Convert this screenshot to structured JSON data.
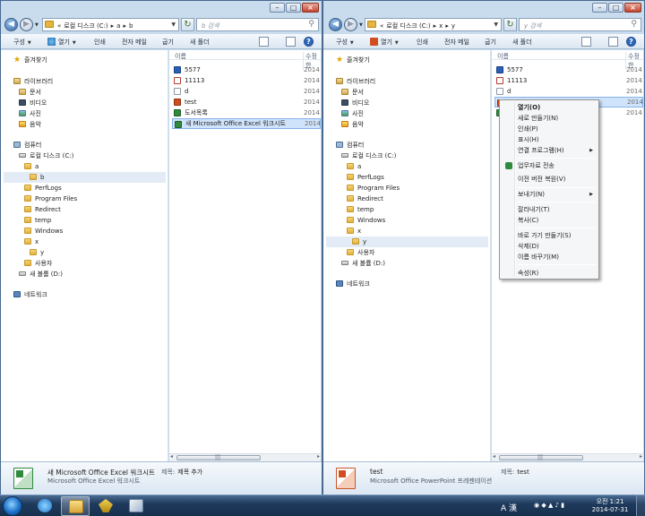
{
  "colors": {
    "window_frame": "#c9dced",
    "selection": "#cfe3fb",
    "taskbar": "#1f3a5c"
  },
  "left": {
    "address": {
      "crumbs": [
        "«",
        "로컬 디스크 (C:)",
        "▸",
        "a",
        "▸",
        "b"
      ]
    },
    "search_placeholder": "b 검색",
    "toolbar": {
      "organize": "구성",
      "open": "열기",
      "print": "인쇄",
      "email": "전자 메일",
      "burn": "굽기",
      "new_folder": "새 폴더"
    },
    "nav": [
      {
        "label": "즐겨찾기",
        "icon": "star-icon",
        "indent": 0
      },
      {
        "label": "라이브러리",
        "icon": "libraries-icon",
        "indent": 0
      },
      {
        "label": "문서",
        "icon": "documents-icon",
        "indent": 1
      },
      {
        "label": "비디오",
        "icon": "videos-icon",
        "indent": 1
      },
      {
        "label": "사진",
        "icon": "pictures-icon",
        "indent": 1
      },
      {
        "label": "음악",
        "icon": "music-icon",
        "indent": 1
      },
      {
        "label": "컴퓨터",
        "icon": "computer-icon",
        "indent": 0
      },
      {
        "label": "로컬 디스크 (C:)",
        "icon": "drive-icon",
        "indent": 1
      },
      {
        "label": "a",
        "icon": "folder-icon",
        "indent": 2
      },
      {
        "label": "b",
        "icon": "folder-icon",
        "indent": 3,
        "selected": true
      },
      {
        "label": "PerfLogs",
        "icon": "folder-icon",
        "indent": 2
      },
      {
        "label": "Program Files",
        "icon": "folder-icon",
        "indent": 2
      },
      {
        "label": "Redirect",
        "icon": "folder-icon",
        "indent": 2
      },
      {
        "label": "temp",
        "icon": "folder-icon",
        "indent": 2
      },
      {
        "label": "Windows",
        "icon": "folder-icon",
        "indent": 2
      },
      {
        "label": "x",
        "icon": "folder-icon",
        "indent": 2
      },
      {
        "label": "y",
        "icon": "folder-icon",
        "indent": 3
      },
      {
        "label": "사용자",
        "icon": "folder-icon",
        "indent": 2
      },
      {
        "label": "새 볼륨 (D:)",
        "icon": "drive-icon",
        "indent": 1
      },
      {
        "label": "네트워크",
        "icon": "network-icon",
        "indent": 0
      }
    ],
    "columns": {
      "name": "이름",
      "date": "수정한"
    },
    "files": [
      {
        "name": "5577",
        "date": "2014",
        "type": "word"
      },
      {
        "name": "11113",
        "date": "2014",
        "type": "pdf"
      },
      {
        "name": "d",
        "date": "2014",
        "type": "doc"
      },
      {
        "name": "test",
        "date": "2014",
        "type": "ppt"
      },
      {
        "name": "도서목록",
        "date": "2014",
        "type": "xls"
      },
      {
        "name": "새 Microsoft Office Excel 워크시트",
        "date": "2014",
        "type": "xls",
        "selected": true
      }
    ],
    "details": {
      "name": "새 Microsoft Office Excel 워크시트",
      "type": "Microsoft Office Excel 워크시트",
      "tag_label": "제목:",
      "tag_value": "제목 추가"
    }
  },
  "right": {
    "address": {
      "crumbs": [
        "«",
        "로컬 디스크 (C:)",
        "▸",
        "x",
        "▸",
        "y"
      ]
    },
    "search_placeholder": "y 검색",
    "toolbar": {
      "organize": "구성",
      "open": "열기",
      "print": "인쇄",
      "email": "전자 메일",
      "burn": "굽기",
      "new_folder": "새 폴더"
    },
    "nav": [
      {
        "label": "즐겨찾기",
        "icon": "star-icon",
        "indent": 0
      },
      {
        "label": "라이브러리",
        "icon": "libraries-icon",
        "indent": 0
      },
      {
        "label": "문서",
        "icon": "documents-icon",
        "indent": 1
      },
      {
        "label": "비디오",
        "icon": "videos-icon",
        "indent": 1
      },
      {
        "label": "사진",
        "icon": "pictures-icon",
        "indent": 1
      },
      {
        "label": "음악",
        "icon": "music-icon",
        "indent": 1
      },
      {
        "label": "컴퓨터",
        "icon": "computer-icon",
        "indent": 0
      },
      {
        "label": "로컬 디스크 (C:)",
        "icon": "drive-icon",
        "indent": 1
      },
      {
        "label": "a",
        "icon": "folder-icon",
        "indent": 2
      },
      {
        "label": "PerfLogs",
        "icon": "folder-icon",
        "indent": 2
      },
      {
        "label": "Program Files",
        "icon": "folder-icon",
        "indent": 2
      },
      {
        "label": "Redirect",
        "icon": "folder-icon",
        "indent": 2
      },
      {
        "label": "temp",
        "icon": "folder-icon",
        "indent": 2
      },
      {
        "label": "Windows",
        "icon": "folder-icon",
        "indent": 2
      },
      {
        "label": "x",
        "icon": "folder-icon",
        "indent": 2
      },
      {
        "label": "y",
        "icon": "folder-icon",
        "indent": 3,
        "selected": true
      },
      {
        "label": "사용자",
        "icon": "folder-icon",
        "indent": 2
      },
      {
        "label": "새 볼륨 (D:)",
        "icon": "drive-icon",
        "indent": 1
      },
      {
        "label": "네트워크",
        "icon": "network-icon",
        "indent": 0
      }
    ],
    "columns": {
      "name": "이름",
      "date": "수정한"
    },
    "files": [
      {
        "name": "5577",
        "date": "2014",
        "type": "word"
      },
      {
        "name": "11113",
        "date": "2014",
        "type": "pdf"
      },
      {
        "name": "d",
        "date": "2014",
        "type": "doc"
      },
      {
        "name": "",
        "date": "2014",
        "type": "ppt",
        "selected": true
      },
      {
        "name": "",
        "date": "2014",
        "type": "xls"
      }
    ],
    "details": {
      "name": "test",
      "type": "Microsoft Office PowerPoint 프레젠테이션",
      "tag_label": "제목:",
      "tag_value": "test"
    }
  },
  "context_menu": {
    "items": [
      {
        "label": "열기(O)",
        "bold": true
      },
      {
        "label": "새로 만들기(N)"
      },
      {
        "label": "인쇄(P)"
      },
      {
        "label": "표시(H)"
      },
      {
        "label": "연결 프로그램(H)",
        "submenu": true
      },
      {
        "sep": true
      },
      {
        "label": "업무자료 전송",
        "icon": true
      },
      {
        "label": "이전 버전 복원(V)"
      },
      {
        "sep": true
      },
      {
        "label": "보내기(N)",
        "submenu": true
      },
      {
        "sep": true
      },
      {
        "label": "잘라내기(T)"
      },
      {
        "label": "복사(C)"
      },
      {
        "sep": true
      },
      {
        "label": "바로 가기 만들기(S)"
      },
      {
        "label": "삭제(D)"
      },
      {
        "label": "이름 바꾸기(M)"
      },
      {
        "sep": true
      },
      {
        "label": "속성(R)"
      }
    ]
  },
  "taskbar": {
    "tray_text": "A 漢",
    "clock_time": "오전 1:21",
    "clock_date": "2014-07-31"
  }
}
